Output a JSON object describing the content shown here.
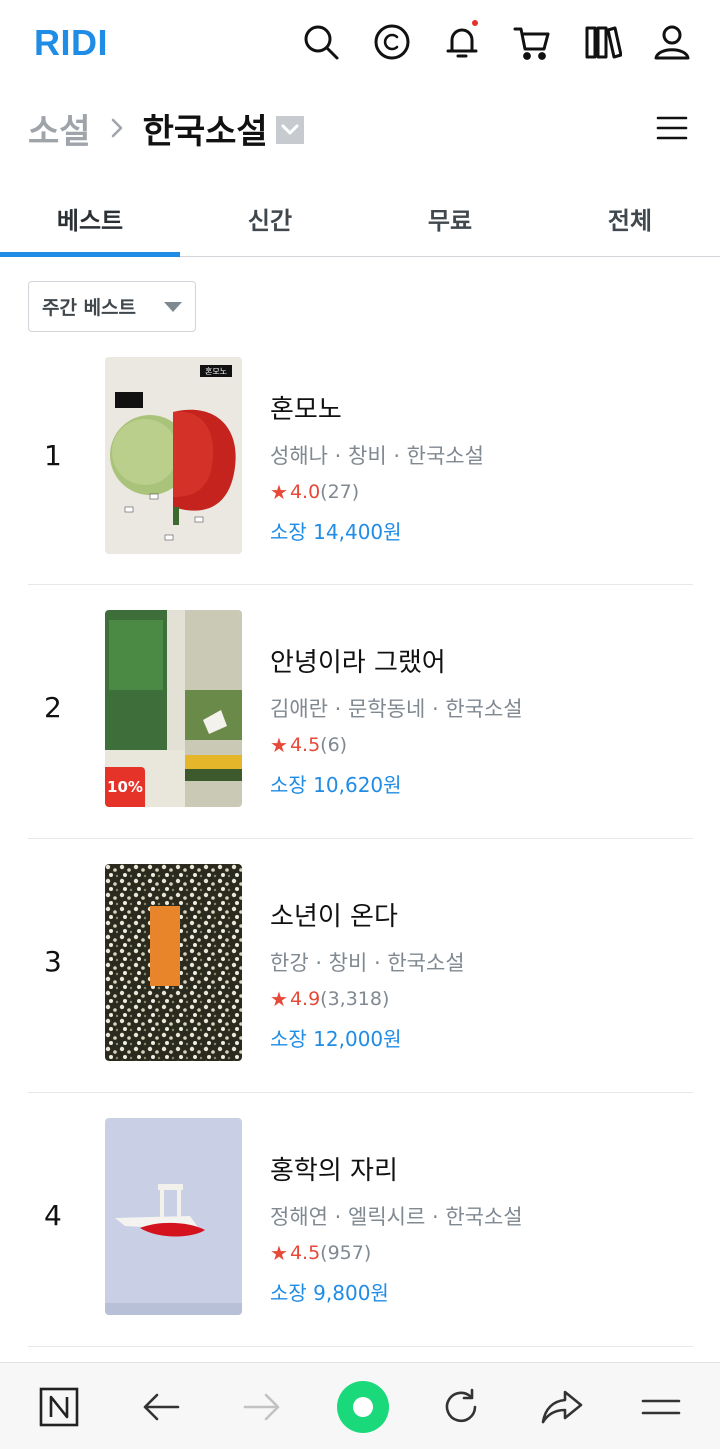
{
  "header": {
    "logo": "RIDI",
    "icons": [
      "search-icon",
      "cash-icon",
      "bell-icon",
      "cart-icon",
      "library-icon",
      "user-icon"
    ]
  },
  "breadcrumb": {
    "parent": "소설",
    "current": "한국소설"
  },
  "tabs": [
    {
      "label": "베스트",
      "active": true
    },
    {
      "label": "신간",
      "active": false
    },
    {
      "label": "무료",
      "active": false
    },
    {
      "label": "전체",
      "active": false
    }
  ],
  "filter": {
    "selected": "주간 베스트"
  },
  "books": [
    {
      "rank": "1",
      "title": "혼모노",
      "author": "성해나",
      "publisher": "창비",
      "category": "한국소설",
      "rating": "4.0",
      "rating_count": "(27)",
      "price": "소장 14,400원",
      "cover_text": "혼모노"
    },
    {
      "rank": "2",
      "title": "안녕이라 그랬어",
      "author": "김애란",
      "publisher": "문학동네",
      "category": "한국소설",
      "rating": "4.5",
      "rating_count": "(6)",
      "price": "소장 10,620원",
      "discount": "10%"
    },
    {
      "rank": "3",
      "title": "소년이 온다",
      "author": "한강",
      "publisher": "창비",
      "category": "한국소설",
      "rating": "4.9",
      "rating_count": "(3,318)",
      "price": "소장 12,000원"
    },
    {
      "rank": "4",
      "title": "홍학의 자리",
      "author": "정해연",
      "publisher": "엘릭시르",
      "category": "한국소설",
      "rating": "4.5",
      "rating_count": "(957)",
      "price": "소장 9,800원"
    }
  ],
  "colors": {
    "brand": "#1f8ce6",
    "star": "#e64938",
    "discount": "#e5332a"
  },
  "browser_bar": {
    "icons": [
      "naver-icon",
      "back-icon",
      "forward-icon",
      "home-circle-icon",
      "refresh-icon",
      "share-icon",
      "menu-icon"
    ]
  }
}
